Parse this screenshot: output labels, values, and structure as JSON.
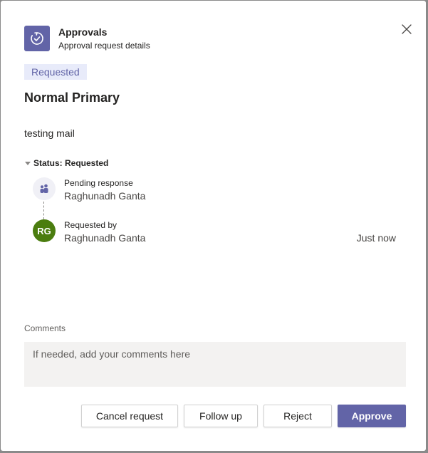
{
  "header": {
    "app_name": "Approvals",
    "subtitle": "Approval request details",
    "app_icon": "approvals-icon",
    "close_icon": "close-icon"
  },
  "request": {
    "status_pill": "Requested",
    "title": "Normal Primary",
    "details": "testing mail"
  },
  "status_section": {
    "label": "Status: Requested",
    "timeline": [
      {
        "caption": "Pending response",
        "name": "Raghunadh Ganta",
        "icon": "people-icon"
      },
      {
        "caption": "Requested by",
        "name": "Raghunadh Ganta",
        "initials": "RG",
        "time": "Just now"
      }
    ]
  },
  "comments": {
    "label": "Comments",
    "placeholder": "If needed, add your comments here",
    "value": ""
  },
  "actions": {
    "cancel": "Cancel request",
    "follow_up": "Follow up",
    "reject": "Reject",
    "approve": "Approve"
  },
  "colors": {
    "brand": "#6264a7",
    "pill_bg": "#e8ebfa",
    "avatar_green": "#4b7d0f"
  }
}
